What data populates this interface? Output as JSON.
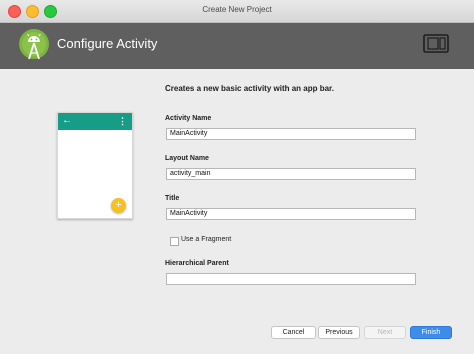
{
  "window": {
    "title": "Create New Project"
  },
  "header": {
    "title": "Configure Activity",
    "logo_icon": "android-studio-logo",
    "device_icon": "phone-tablet-icon"
  },
  "main": {
    "subtitle": "Creates a new basic activity with an app bar.",
    "preview": {
      "back_glyph": "←",
      "menu_glyph": "⋮",
      "fab_glyph": "+",
      "accent_color": "#179c86",
      "fab_color": "#f6c11b"
    },
    "fields": [
      {
        "label": "Activity Name",
        "value": "MainActivity"
      },
      {
        "label": "Layout Name",
        "value": "activity_main"
      },
      {
        "label": "Title",
        "value": "MainActivity"
      },
      {
        "label": "Hierarchical Parent",
        "value": ""
      }
    ],
    "fragment_checkbox": {
      "label": "Use a Fragment",
      "checked": false
    }
  },
  "footer": {
    "cancel": "Cancel",
    "previous": "Previous",
    "next": "Next",
    "finish": "Finish",
    "finish_color": "#3d8de8"
  }
}
